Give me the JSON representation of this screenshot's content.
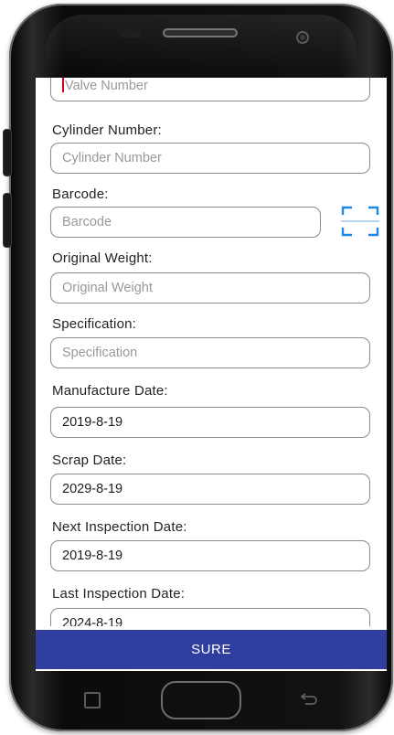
{
  "form": {
    "valve_number_placeholder": "Valve Number",
    "cylinder_number_label": "Cylinder Number:",
    "cylinder_number_placeholder": "Cylinder Number",
    "barcode_label": "Barcode:",
    "barcode_placeholder": "Barcode",
    "original_weight_label": "Original Weight:",
    "original_weight_placeholder": "Original Weight",
    "specification_label": "Specification:",
    "specification_placeholder": "Specification",
    "manufacture_date_label": "Manufacture Date:",
    "manufacture_date_value": "2019-8-19",
    "scrap_date_label": "Scrap Date:",
    "scrap_date_value": "2029-8-19",
    "next_inspection_date_label": "Next Inspection Date:",
    "next_inspection_date_value": "2019-8-19",
    "last_inspection_date_label": "Last Inspection Date:",
    "last_inspection_date_value": "2024-8-19"
  },
  "actions": {
    "sure_label": "SURE"
  },
  "colors": {
    "primary_button": "#303f9f",
    "scan_icon": "#1e88e5",
    "cursor": "#d0021b"
  },
  "icons": {
    "scan": "scan-barcode-icon",
    "recent_apps": "recent-apps-icon",
    "back": "back-arrow-icon"
  }
}
